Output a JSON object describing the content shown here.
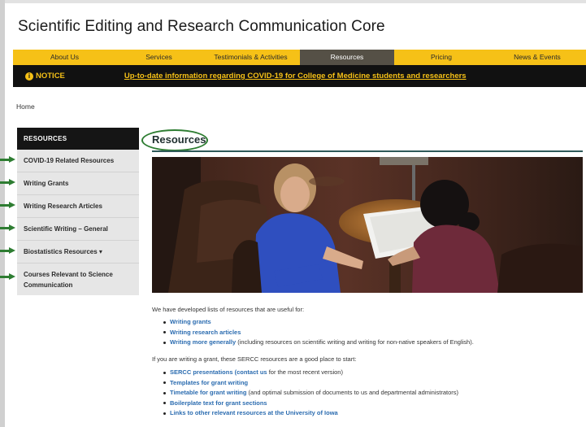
{
  "site": {
    "title": "Scientific Editing and Research Communication Core",
    "accent_color": "#f6c117"
  },
  "nav": {
    "items": [
      {
        "label": "About Us"
      },
      {
        "label": "Services"
      },
      {
        "label": "Testimonials & Activities"
      },
      {
        "label": "Resources",
        "active": true
      },
      {
        "label": "Pricing"
      },
      {
        "label": "News & Events"
      }
    ]
  },
  "notice": {
    "label": "NOTICE",
    "icon": "info-icon",
    "link_text": "Up-to-date information regarding COVID-19 for College of Medicine students and researchers"
  },
  "breadcrumb": {
    "home": "Home"
  },
  "sidebar": {
    "heading": "RESOURCES",
    "items": [
      {
        "label": "COVID-19 Related Resources"
      },
      {
        "label": "Writing Grants"
      },
      {
        "label": "Writing Research Articles"
      },
      {
        "label": "Scientific Writing – General"
      },
      {
        "label": "Biostatistics Resources ▾"
      },
      {
        "label": "Courses Relevant to Science Communication"
      }
    ]
  },
  "main": {
    "title": "Resources",
    "intro": "We have developed lists of resources that are useful for:",
    "useful_for": [
      {
        "link": "Writing grants",
        "rest": ""
      },
      {
        "link": "Writing research articles",
        "rest": ""
      },
      {
        "link": "Writing more generally",
        "rest": " (including resources on scientific writing and writing for non-native speakers of English)."
      }
    ],
    "grant_intro": "If you are writing a grant, these SERCC resources are a good place to start:",
    "grant_resources": [
      {
        "link": "SERCC presentations (contact us",
        "rest": " for the most recent version)"
      },
      {
        "link": "Templates for grant writing",
        "rest": ""
      },
      {
        "link": "Timetable for grant writing",
        "rest": " (and optimal submission of documents to us and departmental administrators)"
      },
      {
        "link": "Boilerplate text for grant sections",
        "rest": ""
      },
      {
        "link": "Links to other relevant resources at the University of Iowa",
        "rest": ""
      }
    ]
  }
}
